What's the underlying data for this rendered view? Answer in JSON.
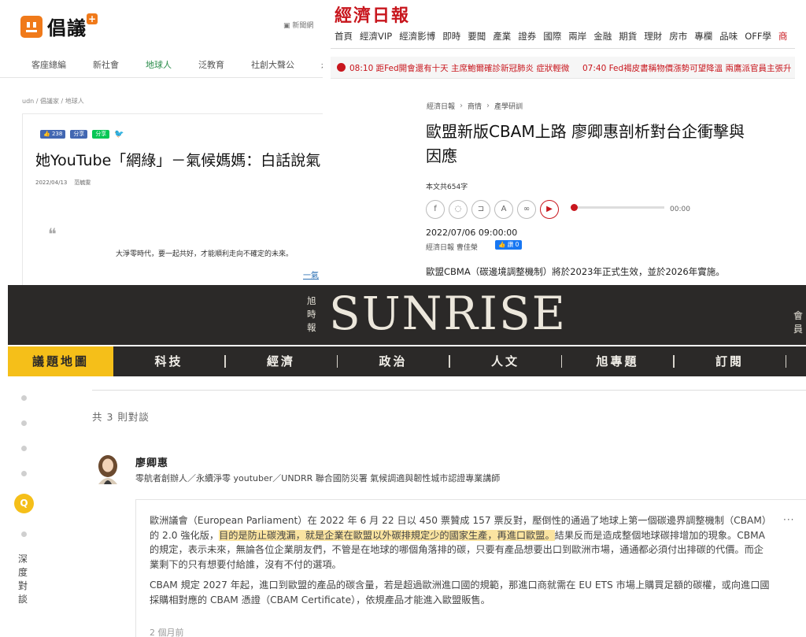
{
  "panel1": {
    "logo_text": "倡議",
    "logo_plus": "+",
    "topright_link": "新聞網",
    "nav": [
      "客座總編",
      "新社會",
      "地球人",
      "泛教育",
      "社創大聲公",
      "永續"
    ],
    "nav_active_index": 2,
    "breadcrumb": "udn / 倡議家 / 地球人",
    "share": {
      "fb": "👍 238",
      "share": "分享",
      "line": "分享"
    },
    "title": "她YouTube「網綠」－氣候媽媽：白話說氣",
    "date": "2022/04/13",
    "author": "范毓雯",
    "quote_mark": "❝",
    "quote_text": "大淨零時代，要一起共好，才能順利走向不確定的未來。",
    "quote_link": "一氣"
  },
  "panel2": {
    "logo": "經濟日報",
    "nav": [
      "首頁",
      "經濟VIP",
      "經濟影博",
      "即時",
      "要聞",
      "產業",
      "證券",
      "國際",
      "兩岸",
      "金融",
      "期貨",
      "理財",
      "房市",
      "專欄",
      "品味",
      "OFF學",
      "商"
    ],
    "ticker_1": "08:10 距Fed開會還有十天 主席鮑爾確診新冠肺炎 症狀輕微",
    "ticker_2": "07:40 Fed褐皮書稱物價漲勢可望降溫 兩鷹派官員主張升",
    "breadcrumb": [
      "經濟日報",
      "商情",
      "產學研訓"
    ],
    "title": "歐盟新版CBAM上路 廖卿惠剖析對台企衝擊與因應",
    "word_count": "本文共654字",
    "audio_time": "00:00",
    "datetime": "2022/07/06 09:00:00",
    "author": "經濟日報 曹佳榮",
    "like_label": "👍 讚 0",
    "lead": "歐盟CBMA（碳邊境調整機制）將於2023年正式生效，並於2026年實施。"
  },
  "panel3": {
    "masthead_cn": "旭時報",
    "brand": "SUNRISE",
    "member": "會員",
    "nav": [
      "議題地圖",
      "科技",
      "經濟",
      "政治",
      "人文",
      "旭專題",
      "訂閱"
    ],
    "active_tab": "議題地圖",
    "side_button": "Q",
    "side_vertical": "深度對談",
    "count_label": "共 3 則對談",
    "user_name": "廖卿惠",
    "user_title": "零航者創辦人／永續淨零 youtuber／UNDRR 聯合國防災署 氣候調適與韌性城市認證專業講師",
    "more": "···",
    "para1_pre": "歐洲議會（European Parliament）在 2022 年 6 月 22 日以 450 票贊成 157 票反對，壓倒性的通過了地球上第一個碳邊界調整機制（CBAM）的 2.0 強化版，",
    "para1_mark": "目的是防止碳洩漏，就是企業在歐盟以外碳排規定少的國家生產，再進口歐盟。",
    "para1_post": "結果反而是造成整個地球碳排增加的現象。CBMA 的規定，表示未來，無論各位企業朋友們，不管是在地球的哪個角落排的碳，只要有產品想要出口到歐洲市場，通通都必須付出排碳的代價。而企業剩下的只有想要付給誰，沒有不付的選項。",
    "para2": "CBAM 規定 2027 年起，進口到歐盟的產品的碳含量，若是超過歐洲進口國的規範，那進口商就需在 EU ETS 市場上購買足額的碳權，或向進口國採購相對應的 CBAM 憑證（CBAM Certificate），依規產品才能進入歐盟販售。",
    "time_ago": "2 個月前",
    "colors": {
      "accent": "#f5bf19",
      "masthead": "#2b2928",
      "highlight": "#fbe4a1"
    }
  }
}
